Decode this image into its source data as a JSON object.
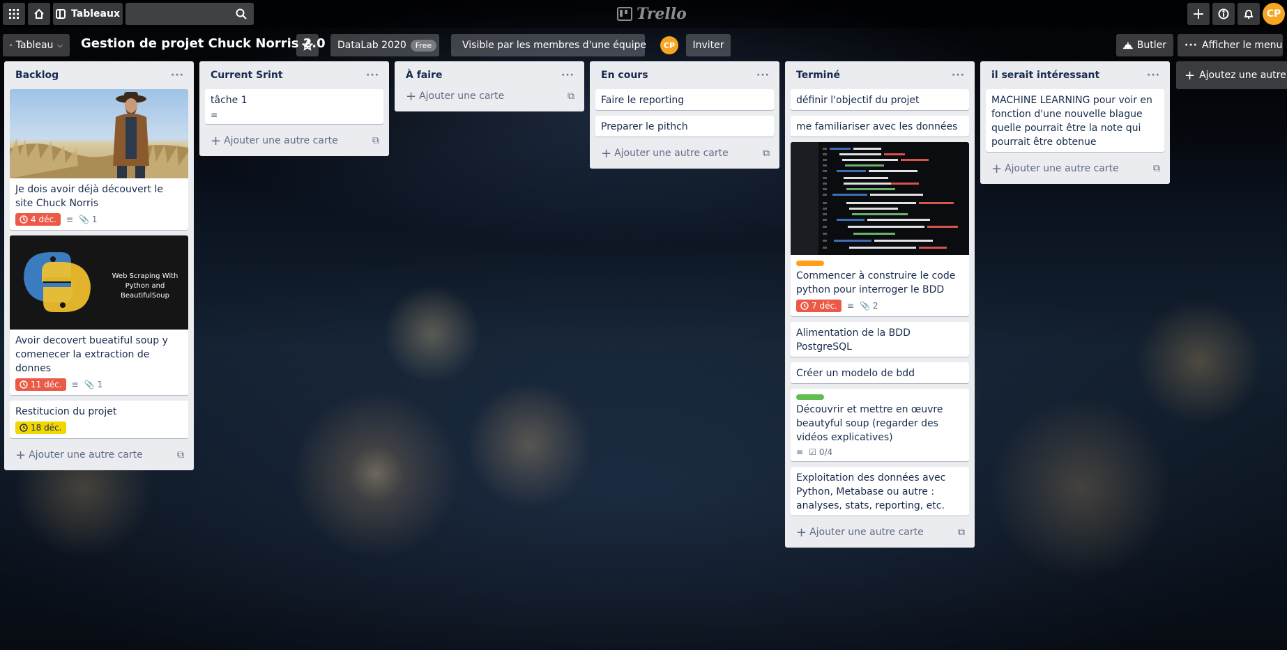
{
  "header": {
    "boards_label": "Tableaux",
    "search_placeholder": "",
    "brand": "Trello",
    "avatar_initials": "CP"
  },
  "board": {
    "view_label": "Tableau",
    "title": "Gestion de projet Chuck Norris 2.0",
    "team_name": "DataLab 2020",
    "team_plan": "Free",
    "visibility": "Visible par les membres d'une équipe",
    "member_initials": "CP",
    "invite_label": "Inviter",
    "butler_label": "Butler",
    "menu_label": "Afficher le menu",
    "add_list_label": "Ajoutez une autre liste"
  },
  "lists": [
    {
      "title": "Backlog",
      "cards": [
        {
          "title": "Je dois avoir déjà découvert le site Chuck Norris",
          "due": "4 déc.",
          "attachments": "1"
        },
        {
          "title": "Avoir decovert bueatiful soup y comenecer la extraction de donnes",
          "due": "11 déc.",
          "attachments": "1",
          "cover_text_1": "Web Scraping With",
          "cover_text_2": "Python and BeautifulSoup"
        },
        {
          "title": "Restitucion du projet",
          "due": "18 déc."
        }
      ],
      "add_label": "Ajouter une autre carte"
    },
    {
      "title": "Current Srint",
      "cards": [
        {
          "title": "tâche 1"
        }
      ],
      "add_label": "Ajouter une autre carte"
    },
    {
      "title": "À faire",
      "cards": [],
      "add_label": "Ajouter une carte"
    },
    {
      "title": "En cours",
      "cards": [
        {
          "title": "Faire le reporting"
        },
        {
          "title": "Preparer le pithch"
        }
      ],
      "add_label": "Ajouter une autre carte"
    },
    {
      "title": "Terminé",
      "cards": [
        {
          "title": "définir l'objectif du projet"
        },
        {
          "title": "me familiariser avec les données"
        },
        {
          "title": "Commencer à construire le code python pour interroger le BDD",
          "due": "7 déc.",
          "attachments": "2",
          "label_color": "#ff9f1a"
        },
        {
          "title": "Alimentation de la BDD PostgreSQL"
        },
        {
          "title": "Créer un modelo de bdd"
        },
        {
          "title": "Découvrir et mettre en œuvre beautyful soup (regarder des vidéos explicatives)",
          "checklist": "0/4",
          "label_color": "#61bd4f"
        },
        {
          "title": "Exploitation des données avec Python, Metabase ou autre : analyses, stats, reporting, etc."
        }
      ],
      "add_label": "Ajouter une autre carte"
    },
    {
      "title": "il serait intéressant",
      "cards": [
        {
          "title": "MACHINE LEARNING pour voir en fonction d'une nouvelle blague quelle pourrait être la note qui pourrait être obtenue"
        }
      ],
      "add_label": "Ajouter une autre carte"
    }
  ],
  "colors": {
    "due_overdue": "#eb5a46",
    "due_soon": "#f2d600",
    "accent_avatar": "#f6a623"
  }
}
